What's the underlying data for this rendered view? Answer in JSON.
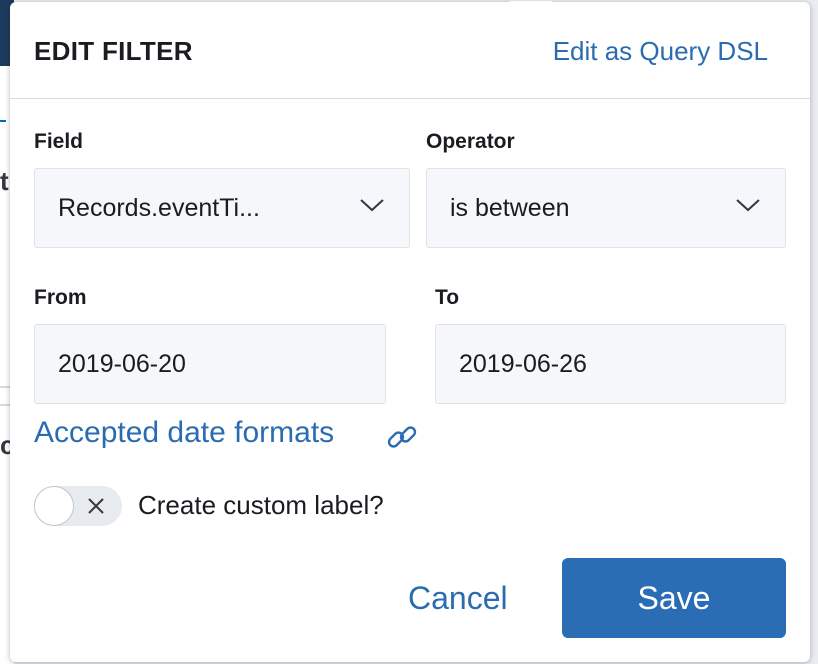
{
  "popover": {
    "title": "EDIT FILTER",
    "edit_dsl_link": "Edit as Query DSL"
  },
  "fields": {
    "field_label": "Field",
    "field_value": "Records.eventTi...",
    "operator_label": "Operator",
    "operator_value": "is between",
    "from_label": "From",
    "from_value": "2019-06-20",
    "to_label": "To",
    "to_value": "2019-06-26"
  },
  "date_formats_link": "Accepted date formats",
  "custom_label": {
    "toggle_on": false,
    "text": "Create custom label?"
  },
  "actions": {
    "cancel": "Cancel",
    "save": "Save"
  },
  "background": {
    "glyph_1": "t",
    "glyph_2": "c"
  },
  "colors": {
    "accent": "#2a6db5",
    "link": "#2b6cb0",
    "text": "#1a1c21"
  },
  "icons": [
    "chevron-down-icon",
    "link-icon",
    "close-icon"
  ]
}
